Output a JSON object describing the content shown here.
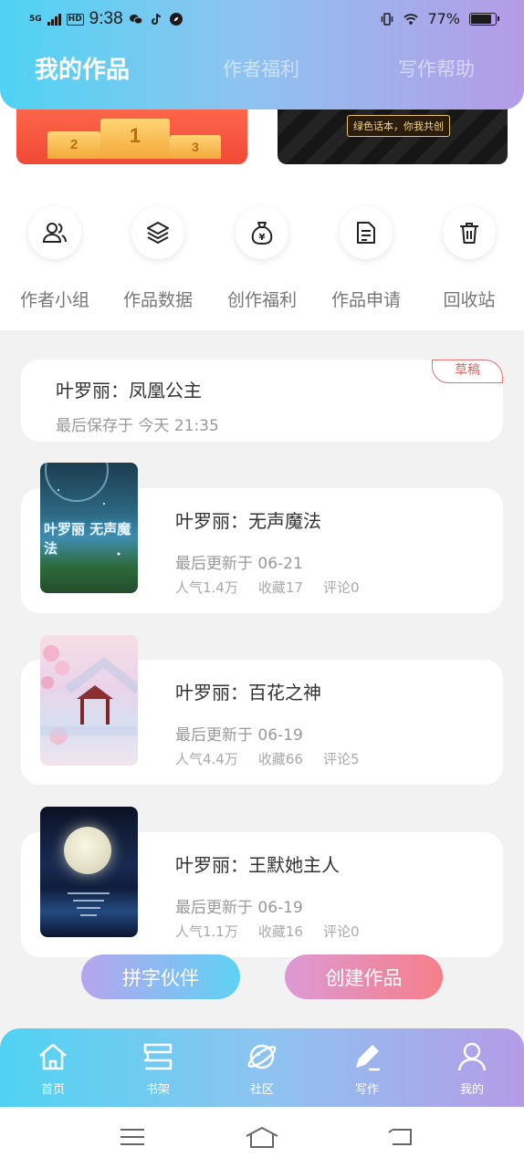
{
  "status": {
    "network": "5G",
    "hd": "HD",
    "time": "9:38",
    "battery": "77%",
    "battery_level": 0.77
  },
  "tabs": [
    {
      "label": "我的作品",
      "active": true
    },
    {
      "label": "作者福利",
      "active": false
    },
    {
      "label": "写作帮助",
      "active": false
    }
  ],
  "banners": {
    "podium": [
      "2",
      "1",
      "3"
    ],
    "slogan": "绿色话本，你我共创"
  },
  "menu": [
    {
      "label": "作者小组",
      "icon": "group-icon"
    },
    {
      "label": "作品数据",
      "icon": "layers-icon"
    },
    {
      "label": "创作福利",
      "icon": "money-bag-icon"
    },
    {
      "label": "作品申请",
      "icon": "document-icon"
    },
    {
      "label": "回收站",
      "icon": "trash-icon"
    }
  ],
  "draft": {
    "title": "叶罗丽：凤凰公主",
    "saved": "最后保存于 今天 21:35",
    "tag": "草稿"
  },
  "works": [
    {
      "title": "叶罗丽：无声魔法",
      "updated": "最后更新于 06-21",
      "popularity": "人气1.4万",
      "favorites": "收藏17",
      "comments": "评论0",
      "cover_text": "叶罗丽 无声魔法"
    },
    {
      "title": "叶罗丽：百花之神",
      "updated": "最后更新于 06-19",
      "popularity": "人气4.4万",
      "favorites": "收藏66",
      "comments": "评论5"
    },
    {
      "title": "叶罗丽：王默她主人",
      "updated": "最后更新于 06-19",
      "popularity": "人气1.1万",
      "favorites": "收藏16",
      "comments": "评论0"
    }
  ],
  "buttons": {
    "partner": "拼字伙伴",
    "create": "创建作品"
  },
  "bottom_nav": [
    {
      "label": "首页",
      "icon": "home-icon"
    },
    {
      "label": "书架",
      "icon": "bookshelf-icon"
    },
    {
      "label": "社区",
      "icon": "planet-icon"
    },
    {
      "label": "写作",
      "icon": "pen-icon"
    },
    {
      "label": "我的",
      "icon": "user-icon"
    }
  ],
  "colors": {
    "gradient_start": "#4fd3f2",
    "gradient_end": "#b59ce8",
    "draft_tag": "#e57373"
  }
}
